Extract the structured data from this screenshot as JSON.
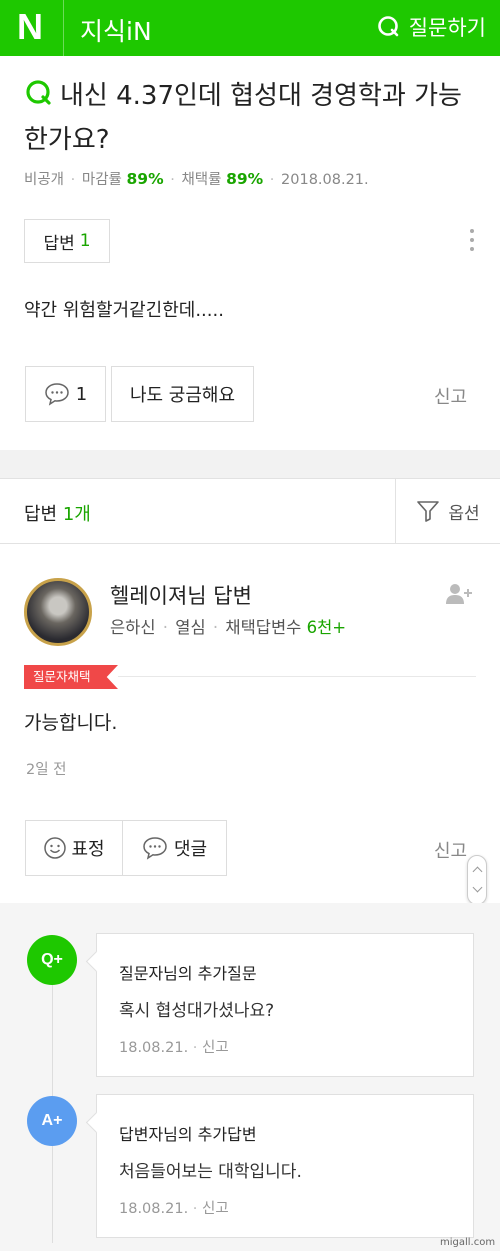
{
  "header": {
    "logo": "N",
    "brand": "지식iN",
    "ask_label": "질문하기",
    "brand_color": "#1ec800"
  },
  "question": {
    "title": "내신 4.37인데 협성대 경영학과 가능한가요?",
    "meta": {
      "visibility": "비공개",
      "closing_rate_label": "마감률",
      "closing_rate": "89%",
      "adoption_rate_label": "채택률",
      "adoption_rate": "89%",
      "date": "2018.08.21."
    },
    "answer_badge_label": "답변",
    "answer_badge_count": "1",
    "body": "약간 위험할거같긴한데.....",
    "comment_count": "1",
    "curious_label": "나도 궁금해요",
    "report_label": "신고"
  },
  "answers_bar": {
    "label": "답변",
    "count": "1개",
    "filter_label": "옵션"
  },
  "answer": {
    "author_title": "헬레이져님 답변",
    "grade": "은하신",
    "activity": "열심",
    "adopted_count_label": "채택답변수",
    "adopted_count": "6천+",
    "tag": "질문자채택",
    "body": "가능합니다.",
    "date": "2일 전",
    "emotion_label": "표정",
    "comment_label": "댓글",
    "report_label": "신고"
  },
  "followups": [
    {
      "badge": "Q+",
      "badge_color": "#1ec800",
      "title": "질문자님의 추가질문",
      "body": "혹시 협성대가셨나요?",
      "date": "18.08.21.",
      "report_label": "신고"
    },
    {
      "badge": "A+",
      "badge_color": "#5b9df0",
      "title": "답변자님의 추가답변",
      "body": "처음들어보는 대학입니다.",
      "date": "18.08.21.",
      "report_label": "신고"
    }
  ],
  "watermark": "migall.com"
}
